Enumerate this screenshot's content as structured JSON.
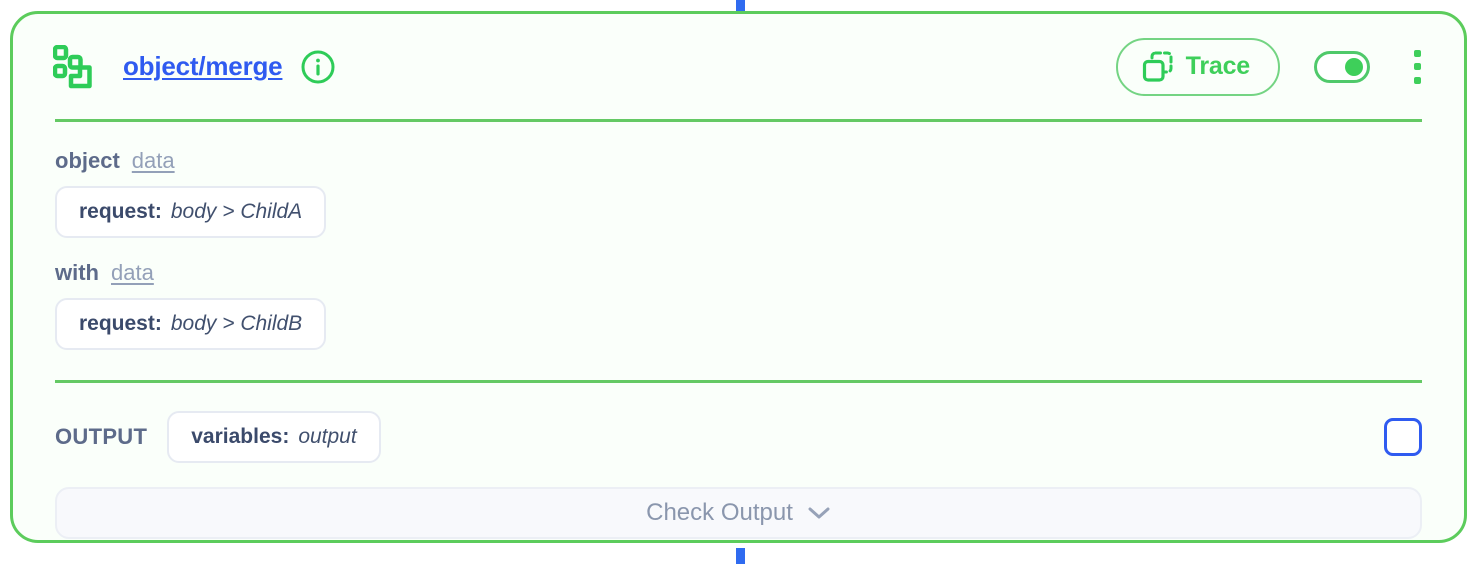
{
  "canvas": {
    "connector_color": "#2f6bf0",
    "node_border_color": "#5ccc5c",
    "node_background": "#fafffa"
  },
  "node": {
    "type_icon": "merge-nodes-icon",
    "title": "object/merge",
    "info_icon": "info-circle-icon",
    "header": {
      "trace": {
        "icon": "copy-trace-icon",
        "label": "Trace"
      },
      "toggle": {
        "name": "node-enabled-toggle",
        "state": "on"
      },
      "menu_icon": "kebab-menu-icon"
    },
    "params": [
      {
        "label": "object",
        "ref_link": "data",
        "chip_key": "request:",
        "chip_value": "body > ChildA"
      },
      {
        "label": "with",
        "ref_link": "data",
        "chip_key": "request:",
        "chip_value": "body > ChildB"
      }
    ],
    "output": {
      "label": "OUTPUT",
      "chip_key": "variables:",
      "chip_value": "output",
      "checkbox_checked": false
    },
    "check_output": {
      "label": "Check Output",
      "chevron_icon": "chevron-down-icon"
    }
  }
}
